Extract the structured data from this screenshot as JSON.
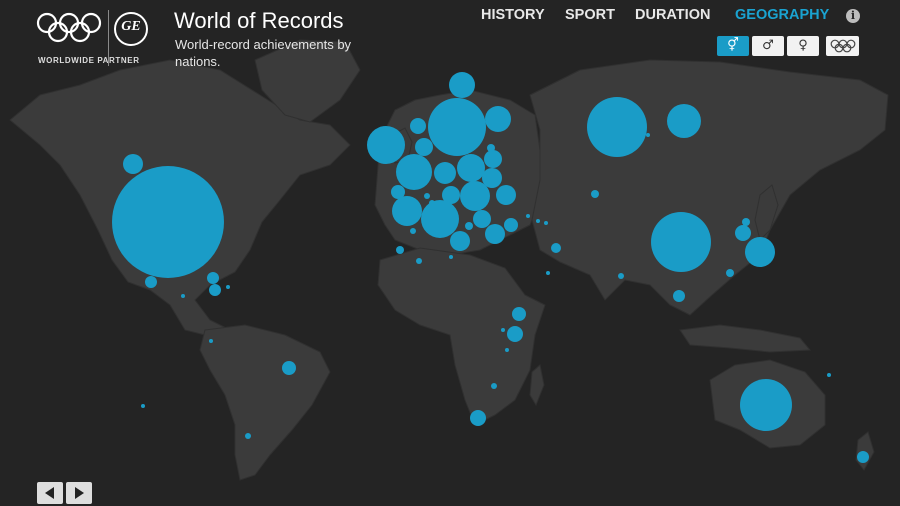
{
  "header": {
    "partner_label": "WORLDWIDE PARTNER",
    "title": "World of Records",
    "subtitle": "World-record achievements by nations."
  },
  "nav": {
    "items": [
      "HISTORY",
      "SPORT",
      "DURATION",
      "GEOGRAPHY"
    ],
    "active": "GEOGRAPHY"
  },
  "filters": {
    "items": [
      {
        "label": "⚥",
        "icon": "both-genders-icon",
        "active": true
      },
      {
        "label": "♂",
        "icon": "male-icon",
        "active": false
      },
      {
        "label": "♀",
        "icon": "female-icon",
        "active": false
      },
      {
        "label": "",
        "icon": "olympic-rings-icon",
        "active": false
      }
    ]
  },
  "controls": {
    "prev": "previous-arrow",
    "next": "next-arrow"
  },
  "colors": {
    "accent": "#1a9cc7",
    "background": "#242424",
    "land": "#3b3b3b",
    "nav_active": "#1aa3d1"
  }
}
